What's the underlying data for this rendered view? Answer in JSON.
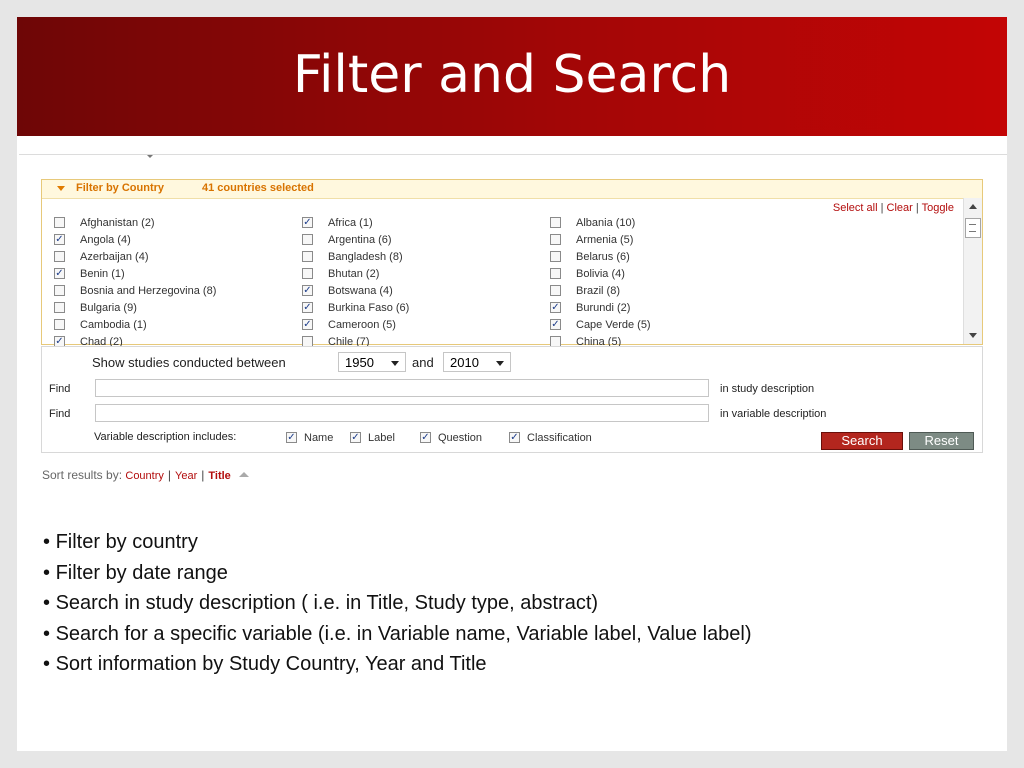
{
  "title": "Filter and Search",
  "filter": {
    "heading": "Filter by Country",
    "count": "41 countries selected",
    "select_all": "Select all",
    "clear": "Clear",
    "toggle": "Toggle",
    "countries": [
      {
        "label": "Afghanistan (2)",
        "checked": false
      },
      {
        "label": "Africa (1)",
        "checked": true
      },
      {
        "label": "Albania (10)",
        "checked": false
      },
      {
        "label": "Angola (4)",
        "checked": true
      },
      {
        "label": "Argentina (6)",
        "checked": false
      },
      {
        "label": "Armenia (5)",
        "checked": false
      },
      {
        "label": "Azerbaijan (4)",
        "checked": false
      },
      {
        "label": "Bangladesh (8)",
        "checked": false
      },
      {
        "label": "Belarus (6)",
        "checked": false
      },
      {
        "label": "Benin (1)",
        "checked": true
      },
      {
        "label": "Bhutan (2)",
        "checked": false
      },
      {
        "label": "Bolivia (4)",
        "checked": false
      },
      {
        "label": "Bosnia and Herzegovina (8)",
        "checked": false
      },
      {
        "label": "Botswana (4)",
        "checked": true
      },
      {
        "label": "Brazil (8)",
        "checked": false
      },
      {
        "label": "Bulgaria (9)",
        "checked": false
      },
      {
        "label": "Burkina Faso (6)",
        "checked": true
      },
      {
        "label": "Burundi (2)",
        "checked": true
      },
      {
        "label": "Cambodia (1)",
        "checked": false
      },
      {
        "label": "Cameroon (5)",
        "checked": true
      },
      {
        "label": "Cape Verde (5)",
        "checked": true
      },
      {
        "label": "Chad (2)",
        "checked": true
      },
      {
        "label": "Chile (7)",
        "checked": false
      },
      {
        "label": "China (5)",
        "checked": false
      }
    ]
  },
  "search": {
    "between_label": "Show studies conducted between",
    "from_year": "1950",
    "and_label": "and",
    "to_year": "2010",
    "find_label": "Find",
    "study_find_value": "",
    "study_desc_label": "in study description",
    "variable_find_value": "",
    "variable_desc_label": "in variable description",
    "includes_label": "Variable description includes:",
    "includes": [
      {
        "label": "Name",
        "checked": true
      },
      {
        "label": "Label",
        "checked": true
      },
      {
        "label": "Question",
        "checked": true
      },
      {
        "label": "Classification",
        "checked": true
      }
    ],
    "search_button": "Search",
    "reset_button": "Reset"
  },
  "sort": {
    "label": "Sort results by:",
    "options": [
      "Country",
      "Year",
      "Title"
    ],
    "active": "Title"
  },
  "bullets": [
    "Filter by country",
    "Filter by date range",
    "Search in study description ( i.e. in Title, Study type, abstract)",
    "Search for a specific variable (i.e. in Variable name, Variable label, Value label)",
    "Sort information by Study Country, Year and Title"
  ],
  "colors": {
    "title_bar": "#a20606",
    "accent_orange": "#d87300",
    "link_red": "#b30d0d",
    "search_button": "#b3261e",
    "reset_button": "#7d8b84"
  }
}
